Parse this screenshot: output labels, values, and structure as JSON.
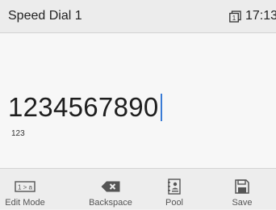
{
  "header": {
    "title": "Speed Dial 1",
    "time": "17:13",
    "status_icon": "line-icon",
    "status_icon_digit": "1"
  },
  "main": {
    "number": "1234567890",
    "input_mode": "123"
  },
  "softkeys": [
    {
      "label": "Edit Mode",
      "icon": "edit-mode-icon",
      "icon_text": "1 > a"
    },
    {
      "label": "Backspace",
      "icon": "backspace-icon"
    },
    {
      "label": "Pool",
      "icon": "pool-icon"
    },
    {
      "label": "Save",
      "icon": "save-icon"
    }
  ],
  "colors": {
    "header_bg": "#ececec",
    "content_bg": "#f7f7f7",
    "softkey_bg": "#ededed",
    "cursor": "#3a7bd5",
    "icon": "#555555"
  }
}
